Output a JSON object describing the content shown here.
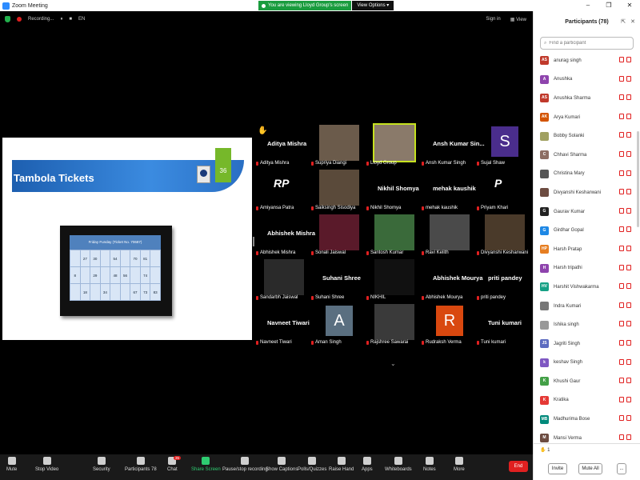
{
  "window": {
    "title": "Zoom Meeting"
  },
  "banner": {
    "share_msg": "You are viewing Lloyd Group's screen",
    "view_options": "View Options"
  },
  "topbar": {
    "recording": "Recording...",
    "pause": "⏸",
    "stop": "■",
    "lang": "EN",
    "sign_in": "Sign in",
    "view": "View"
  },
  "slide": {
    "title": "Tambola Tickets",
    "number": "36",
    "ticket_header": "Friday Funday (Ticket No. 70687)",
    "ticket_rows": [
      [
        "",
        "27",
        "30",
        "",
        "54",
        "",
        "70",
        "81"
      ],
      [
        "8",
        "",
        "29",
        "",
        "48",
        "56",
        "",
        "74"
      ],
      [
        "",
        "18",
        "",
        "34",
        "",
        "",
        "67",
        "73",
        "83"
      ]
    ]
  },
  "tiles": [
    [
      {
        "type": "big",
        "big": "Aditya Mishra",
        "label": "Aditya Mishra"
      },
      {
        "type": "video",
        "label": "Supriya Diangi",
        "bg": "#6b5b4b"
      },
      {
        "type": "video",
        "label": "Lloyd Group",
        "bg": "#8a7a6a",
        "active": true
      },
      {
        "type": "big",
        "big": "Ansh Kumar Sin...",
        "label": "Ansh Kumar Singh"
      },
      {
        "type": "letter",
        "letter": "S",
        "label": "Sujal Shaw",
        "bg": "#4a2d8c"
      }
    ],
    [
      {
        "type": "logo",
        "big": "RP",
        "label": "Amiyansa Patra"
      },
      {
        "type": "video",
        "label": "Saiksingh Sisodiya",
        "bg": "#5a4a3a"
      },
      {
        "type": "big",
        "big": "Nikhil Shomya",
        "label": "Nikhil Shomya"
      },
      {
        "type": "big",
        "big": "mehak kaushik",
        "label": "mehak kaushik"
      },
      {
        "type": "logo",
        "big": "P",
        "label": "Priyam Khari"
      }
    ],
    [
      {
        "type": "big",
        "big": "Abhishek Mishra",
        "label": "Abhishek Mishra"
      },
      {
        "type": "video",
        "label": "Sonali Jaiswal",
        "bg": "#5a1a2a"
      },
      {
        "type": "video",
        "label": "Santosh Kumar",
        "bg": "#3a6a3a"
      },
      {
        "type": "video",
        "label": "Ravi Kelith",
        "bg": "#4a4a4a"
      },
      {
        "type": "video",
        "label": "Divyanshi Kesharwani",
        "bg": "#4a3a2a"
      }
    ],
    [
      {
        "type": "video",
        "label": "Sandarbh Jaiswal",
        "bg": "#2a2a2a"
      },
      {
        "type": "big",
        "big": "Suhani Shree",
        "label": "Suhani Shree"
      },
      {
        "type": "video",
        "label": "NIKHIL",
        "bg": "#111111"
      },
      {
        "type": "big",
        "big": "Abhishek Mourya",
        "label": "Abhishek Mourya"
      },
      {
        "type": "big",
        "big": "priti pandey",
        "label": "priti pandey"
      }
    ],
    [
      {
        "type": "big",
        "big": "Navneet Tiwari",
        "label": "Navneet Tiwari"
      },
      {
        "type": "letter",
        "letter": "A",
        "label": "Aman Singh",
        "bg": "#5a6f80"
      },
      {
        "type": "video",
        "label": "Rajshree Sawarai",
        "bg": "#3a3a3a"
      },
      {
        "type": "letter",
        "letter": "R",
        "label": "Rudraksh Verma",
        "bg": "#d9480f"
      },
      {
        "type": "big",
        "big": "Tuni kumari",
        "label": "Tuni kumari"
      }
    ]
  ],
  "toolbar": {
    "mute": "Mute",
    "stop_video": "Stop Video",
    "security": "Security",
    "participants": "Participants",
    "participants_count": "78",
    "chat": "Chat",
    "chat_badge": "35",
    "share_screen": "Share Screen",
    "pause_rec": "Pause/stop recording",
    "captions": "Show Captions",
    "polls": "Polls/Quizzes",
    "raise_hand": "Raise Hand",
    "apps": "Apps",
    "whiteboards": "Whiteboards",
    "notes": "Notes",
    "more": "More",
    "end": "End"
  },
  "panel": {
    "title": "Participants (78)",
    "search_placeholder": "Find a participant",
    "participants": [
      {
        "initials": "AS",
        "name": "anurag singh",
        "color": "#c0392b"
      },
      {
        "initials": "A",
        "name": "Anushka",
        "color": "#8e44ad"
      },
      {
        "initials": "AS",
        "name": "Anushka Sharma",
        "color": "#c0392b"
      },
      {
        "initials": "AK",
        "name": "Arya Kumari",
        "color": "#d35400"
      },
      {
        "initials": "",
        "name": "Bobby Solanki",
        "color": "#a0a060"
      },
      {
        "initials": "C",
        "name": "Chhavi Sharma",
        "color": "#8d6e63"
      },
      {
        "initials": "",
        "name": "Christina Mary",
        "color": "#555555"
      },
      {
        "initials": "",
        "name": "Divyanshi Kesharwani",
        "color": "#6d4c41"
      },
      {
        "initials": "G",
        "name": "Gaurav Kumar",
        "color": "#222222"
      },
      {
        "initials": "G",
        "name": "Girdhar Gopal",
        "color": "#1e88e5"
      },
      {
        "initials": "HP",
        "name": "Harsh Pratap",
        "color": "#e67e22"
      },
      {
        "initials": "H",
        "name": "Harsh tripathi",
        "color": "#8e44ad"
      },
      {
        "initials": "HV",
        "name": "Harshit Vishwakarma",
        "color": "#16a085"
      },
      {
        "initials": "",
        "name": "Indra Kumari",
        "color": "#777777"
      },
      {
        "initials": "",
        "name": "Ishika singh",
        "color": "#999999"
      },
      {
        "initials": "JS",
        "name": "Jagriti Singh",
        "color": "#5c6bc0"
      },
      {
        "initials": "k",
        "name": "keshav Singh",
        "color": "#7e57c2"
      },
      {
        "initials": "K",
        "name": "Khushi Gaur",
        "color": "#43a047"
      },
      {
        "initials": "K",
        "name": "Kratika",
        "color": "#e53935"
      },
      {
        "initials": "MB",
        "name": "Madhurima Bose",
        "color": "#00897b"
      },
      {
        "initials": "M",
        "name": "Mansi Verma",
        "color": "#6d4c41"
      }
    ],
    "hand_count": "1",
    "invite": "Invite",
    "mute_all": "Mute All",
    "more": "..."
  }
}
